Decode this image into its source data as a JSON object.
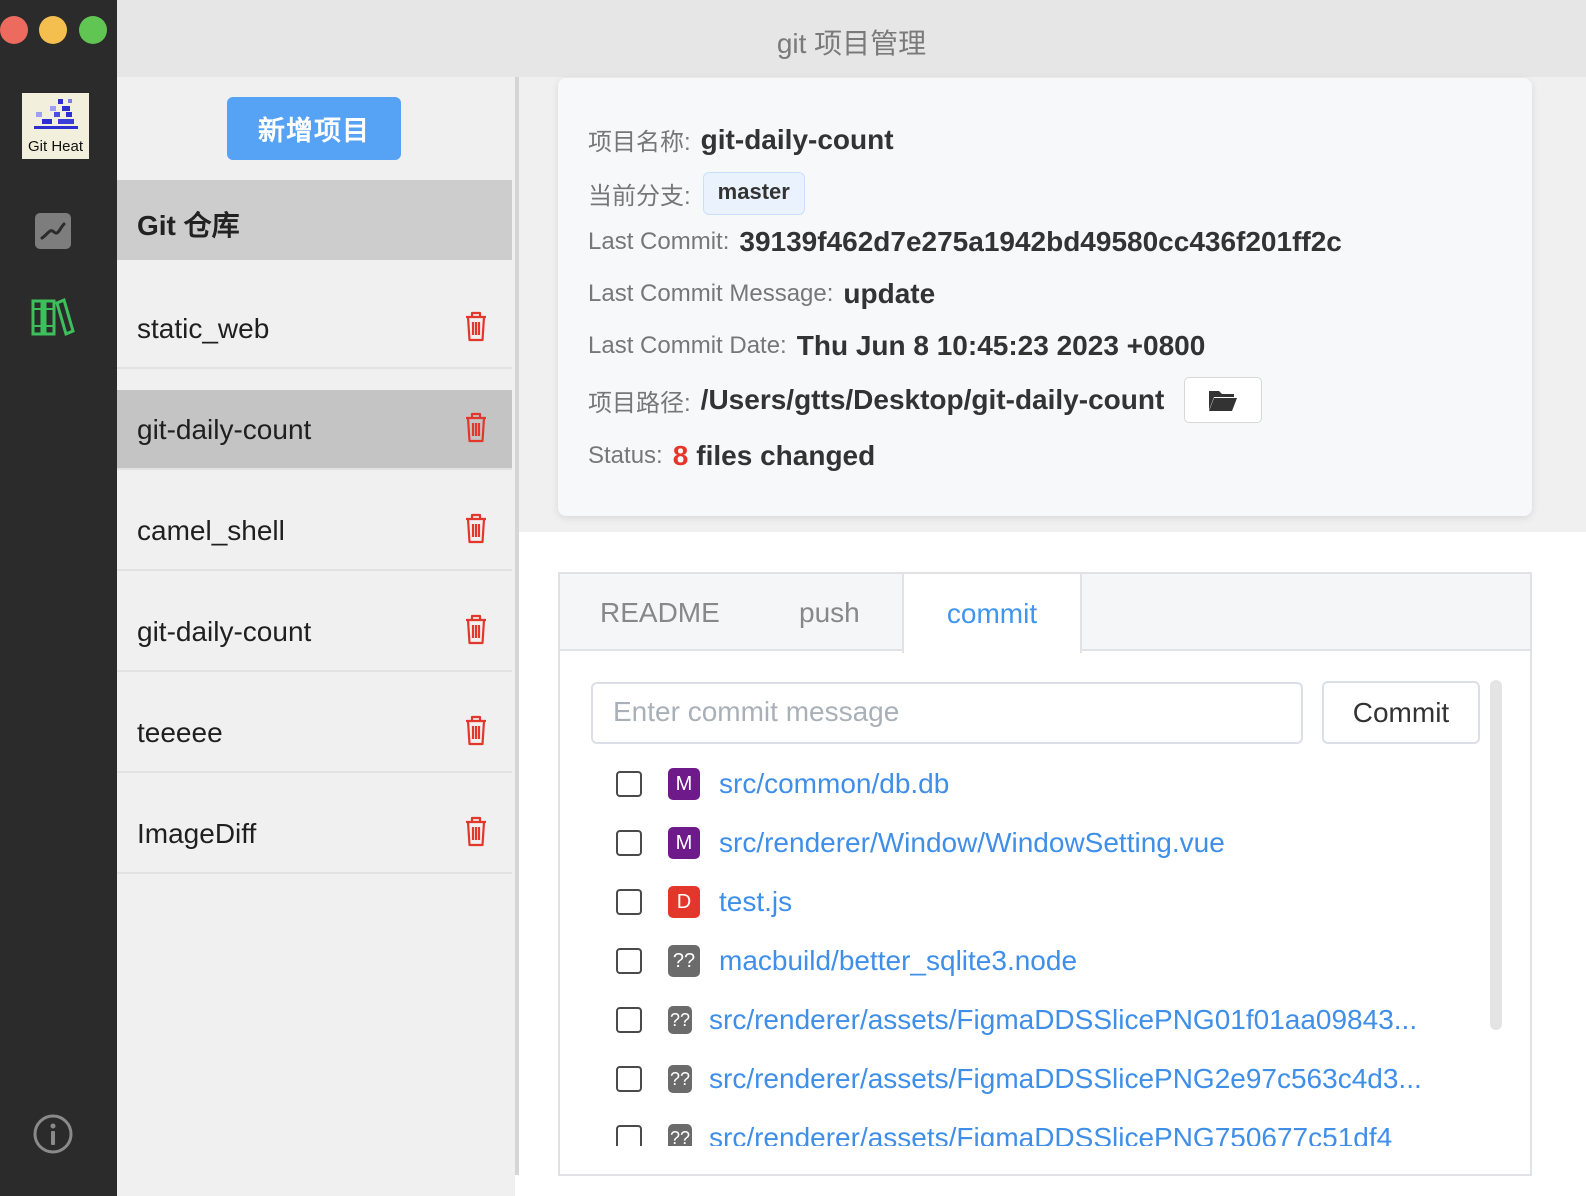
{
  "window": {
    "title": "git 项目管理"
  },
  "rail": {
    "logo_text": "Git Heat",
    "icons": [
      "chart-icon",
      "books-icon",
      "info-icon"
    ]
  },
  "list": {
    "add_button": "新增项目",
    "header": "Git 仓库",
    "projects": [
      {
        "name": "static_web"
      },
      {
        "name": "git-daily-count",
        "active": true
      },
      {
        "name": "camel_shell"
      },
      {
        "name": "git-daily-count"
      },
      {
        "name": "teeeee"
      },
      {
        "name": "ImageDiff"
      }
    ]
  },
  "detail": {
    "name_label": "项目名称:",
    "name_value": "git-daily-count",
    "branch_label": "当前分支:",
    "branch_value": "master",
    "commit_label": "Last Commit:",
    "commit_value": "39139f462d7e275a1942bd49580cc436f201ff2c",
    "message_label": "Last Commit Message:",
    "message_value": "update",
    "date_label": "Last Commit Date:",
    "date_value": "Thu Jun 8 10:45:23 2023 +0800",
    "path_label": "项目路径:",
    "path_value": "/Users/gtts/Desktop/git-daily-count",
    "status_label": "Status:",
    "status_count": "8",
    "status_text": "files changed"
  },
  "tabs": {
    "items": [
      "README",
      "push",
      "commit"
    ],
    "active": "commit"
  },
  "commit": {
    "placeholder": "Enter commit message",
    "button": "Commit",
    "files": [
      {
        "status": "M",
        "path": "src/common/db.db"
      },
      {
        "status": "M",
        "path": "src/renderer/Window/WindowSetting.vue"
      },
      {
        "status": "D",
        "path": "test.js"
      },
      {
        "status": "??",
        "path": "macbuild/better_sqlite3.node"
      },
      {
        "status": "??",
        "path": "src/renderer/assets/FigmaDDSSlicePNG01f01aa09843..."
      },
      {
        "status": "??",
        "path": "src/renderer/assets/FigmaDDSSlicePNG2e97c563c4d3..."
      },
      {
        "status": "??",
        "path": "src/renderer/assets/FigmaDDSSlicePNG750677c51df4"
      }
    ]
  },
  "colors": {
    "accent": "#56a2f5",
    "link": "#3f8fe8",
    "danger": "#e4372b",
    "modified": "#6e1a8a",
    "untracked": "#6b6b6b"
  }
}
